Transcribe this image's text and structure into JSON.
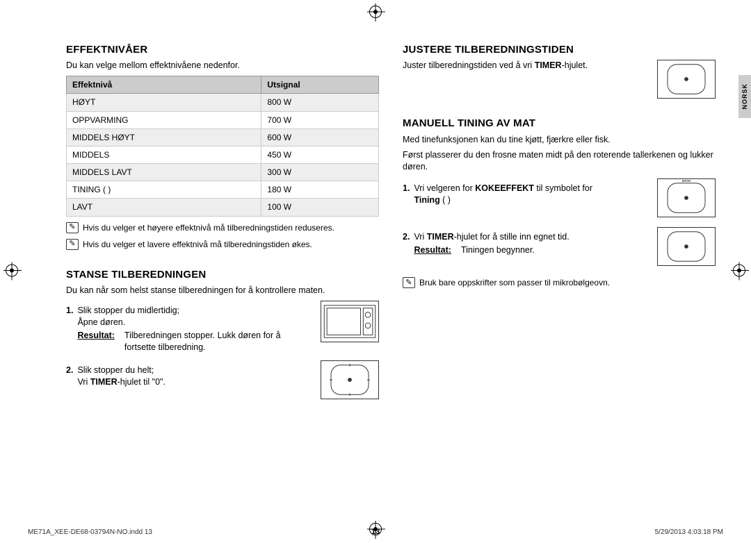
{
  "cropmarks": {
    "glyph": "⊕"
  },
  "lang_tab": "NORSK",
  "page_number": "13",
  "footer": {
    "left": "ME71A_XEE-DE68-03794N-NO.indd   13",
    "right": "5/29/2013   4:03:18 PM"
  },
  "left": {
    "section1": {
      "heading": "EFFEKTNIVÅER",
      "intro": "Du kan velge mellom effektnivåene nedenfor.",
      "table": {
        "headers": [
          "Effektnivå",
          "Utsignal"
        ],
        "rows": [
          [
            "HØYT",
            "800 W"
          ],
          [
            "OPPVARMING",
            "700 W"
          ],
          [
            "MIDDELS HØYT",
            "600 W"
          ],
          [
            "MIDDELS",
            "450 W"
          ],
          [
            "MIDDELS LAVT",
            "300 W"
          ],
          [
            "TINING ( )",
            "180 W"
          ],
          [
            "LAVT",
            "100 W"
          ]
        ]
      },
      "notes": [
        "Hvis du velger et høyere effektnivå må tilberedningstiden reduseres.",
        "Hvis du velger et lavere effektnivå må tilberedningstiden økes."
      ]
    },
    "section2": {
      "heading": "STANSE TILBEREDNINGEN",
      "intro": "Du kan når som helst stanse tilberedningen for å kontrollere maten.",
      "steps": [
        {
          "num": "1.",
          "line1": "Slik stopper du midlertidig;",
          "line2": "Åpne døren.",
          "result_label": "Resultat:",
          "result_text": "Tilberedningen stopper. Lukk døren for å fortsette tilberedning.",
          "illus": "microwave"
        },
        {
          "num": "2.",
          "line1": "Slik stopper du helt;",
          "line2_prefix": "Vri ",
          "line2_bold": "TIMER",
          "line2_suffix": "-hjulet til \"0\".",
          "illus": "timer-dial"
        }
      ]
    }
  },
  "right": {
    "section1": {
      "heading": "JUSTERE TILBEREDNINGSTIDEN",
      "intro_prefix": "Juster tilberedningstiden ved å vri ",
      "intro_bold": "TIMER",
      "intro_suffix": "-hjulet.",
      "illus": "timer-dial"
    },
    "section2": {
      "heading": "MANUELL TINING AV MAT",
      "intro1": "Med tinefunksjonen kan du tine kjøtt, fjærkre eller fisk.",
      "intro2": "Først plasserer du den frosne maten midt på den roterende tallerkenen og lukker døren.",
      "steps": [
        {
          "num": "1.",
          "text_prefix": "Vri velgeren for ",
          "text_bold1": "KOKEEFFEKT",
          "text_mid": " til symbolet for ",
          "text_bold2": "Tining",
          "text_suffix": " ( )",
          "illus": "power-dial"
        },
        {
          "num": "2.",
          "text_prefix": "Vri ",
          "text_bold1": "TIMER",
          "text_suffix": "-hjulet for å stille inn egnet tid.",
          "result_label": "Resultat:",
          "result_text": "Tiningen begynner.",
          "illus": "timer-dial"
        }
      ],
      "note": "Bruk bare oppskrifter som passer til mikrobølgeovn."
    }
  },
  "icons": {
    "defrost": "⬣⬣"
  }
}
